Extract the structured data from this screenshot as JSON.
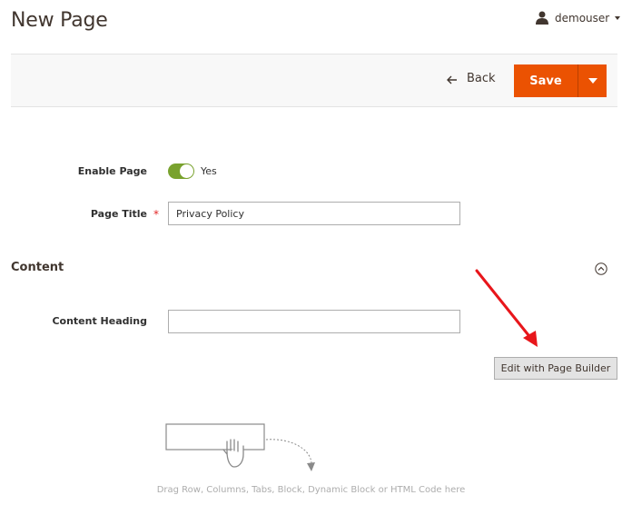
{
  "header": {
    "title": "New Page",
    "user": {
      "name": "demouser",
      "icon": "user-icon"
    }
  },
  "actions": {
    "back_label": "Back",
    "save_label": "Save",
    "save_color": "#eb5202"
  },
  "form": {
    "enable_page": {
      "label": "Enable Page",
      "state_text": "Yes",
      "enabled": true,
      "color": "#79a22e"
    },
    "page_title": {
      "label": "Page Title",
      "required_mark": "*",
      "value": "Privacy Policy"
    }
  },
  "content": {
    "section_title": "Content",
    "content_heading": {
      "label": "Content Heading",
      "value": ""
    },
    "page_builder_button": "Edit with Page Builder",
    "drop_hint": "Drag Row, Columns, Tabs, Block, Dynamic Block or HTML Code here"
  }
}
